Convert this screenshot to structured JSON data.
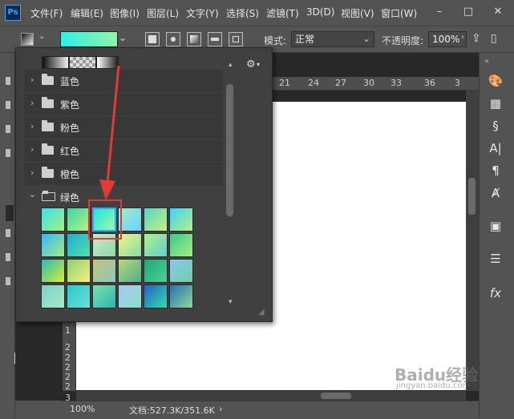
{
  "app": {
    "logo": "Ps"
  },
  "menu": [
    "文件(F)",
    "编辑(E)",
    "图像(I)",
    "图层(L)",
    "文字(Y)",
    "选择(S)",
    "滤镜(T)",
    "3D(D)",
    "视图(V)",
    "窗口(W)"
  ],
  "window_controls": {
    "minimize": "–",
    "maximize": "□",
    "close": "✕"
  },
  "options_bar": {
    "gradient_preview": {
      "from": "#2ef0e6",
      "to": "#8ff5a8"
    },
    "mode_label": "模式:",
    "mode_value": "正常",
    "opacity_label": "不透明度:",
    "opacity_value": "100%"
  },
  "ruler": {
    "top_ticks": [
      "21",
      "24",
      "27",
      "30",
      "33",
      "36",
      "3"
    ],
    "left_ticks": [
      "1",
      "2",
      "2",
      "2",
      "2",
      "2",
      "3"
    ]
  },
  "status": {
    "zoom": "100%",
    "doc_info": "文档:527.3K/351.6K"
  },
  "gradient_picker": {
    "folders": [
      {
        "name": "蓝色",
        "expanded": false
      },
      {
        "name": "紫色",
        "expanded": false
      },
      {
        "name": "粉色",
        "expanded": false
      },
      {
        "name": "红色",
        "expanded": false
      },
      {
        "name": "橙色",
        "expanded": false
      },
      {
        "name": "绿色",
        "expanded": true
      }
    ],
    "green_swatches": [
      [
        "#39e0f0",
        "#a8f07a"
      ],
      [
        "#38d6a0",
        "#b8f28a"
      ],
      [
        "#19e8e0",
        "#a0f5a8"
      ],
      [
        "#9cf0c8",
        "#6ad0ff"
      ],
      [
        "#52d4c8",
        "#c8f07a"
      ],
      [
        "#3ad2ff",
        "#b9f07c"
      ],
      [
        "#3ab4ff",
        "#9cf07c"
      ],
      [
        "#1ab0d8",
        "#52e09c"
      ],
      [
        "#c7e8c8",
        "#8fd8a8"
      ],
      [
        "#f4f08a",
        "#7ee0a0"
      ],
      [
        "#aef08c",
        "#62d0c8"
      ],
      [
        "#3ac88c",
        "#a4f07c"
      ],
      [
        "#2ab8b8",
        "#d8f02c"
      ],
      [
        "#8cd070",
        "#f8f07c"
      ],
      [
        "#c4c47c",
        "#8cc8b8"
      ],
      [
        "#b8d87c",
        "#4cb08c"
      ],
      [
        "#1ea878",
        "#4cd094"
      ],
      [
        "#8cc8f0",
        "#6ad0a8"
      ],
      [
        "#7cd0c8",
        "#a8e8c8"
      ],
      [
        "#2ac8c8",
        "#6ae0d8"
      ],
      [
        "#7ce0a8",
        "#2ab8b0"
      ],
      [
        "#a8c8f0",
        "#8ce0c8"
      ],
      [
        "#2860c8",
        "#2ae0a8"
      ],
      [
        "#2870b8",
        "#8cd890"
      ]
    ]
  },
  "right_panel": [
    {
      "icon": "palette-icon",
      "glyph": "🎨"
    },
    {
      "icon": "grid-icon",
      "glyph": "▦"
    },
    {
      "icon": "paragraph-style-icon",
      "glyph": "§"
    },
    {
      "icon": "character-icon",
      "glyph": "A|"
    },
    {
      "icon": "paragraph-icon",
      "glyph": "¶"
    },
    {
      "icon": "glyph-icon",
      "glyph": "Ⱥ"
    },
    {
      "icon": "clipboard-icon",
      "glyph": "▣"
    },
    {
      "icon": "adjustments-icon",
      "glyph": "☰"
    },
    {
      "icon": "fx-icon",
      "glyph": "fx"
    }
  ],
  "watermark": {
    "text": "Baidu经验",
    "url": "jingyan.baidu.com"
  }
}
